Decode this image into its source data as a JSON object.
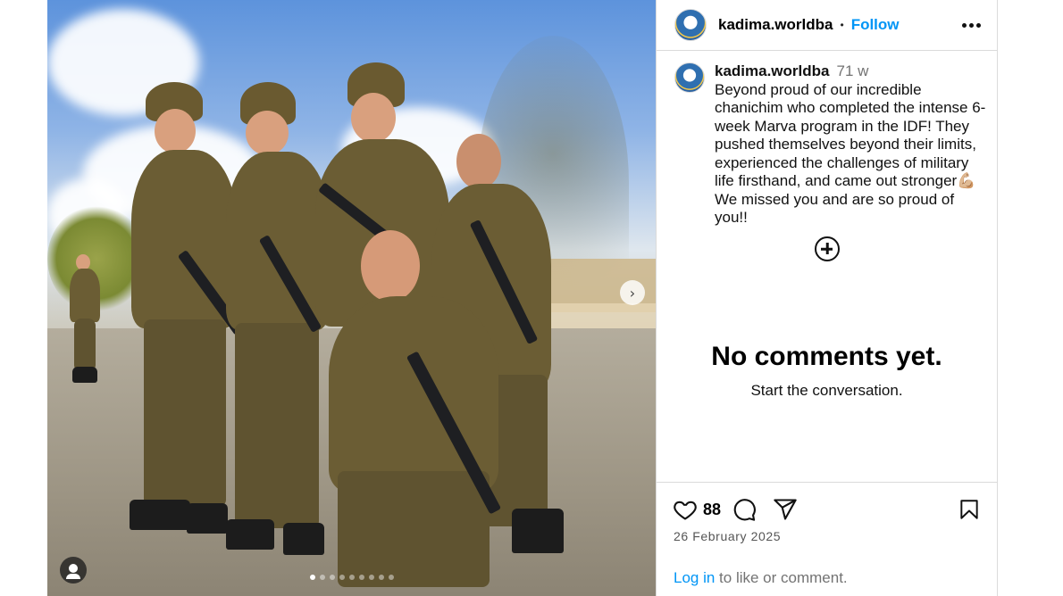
{
  "media": {
    "next_icon": "chevron-right-icon",
    "carousel_slides": 9,
    "active_slide": 1
  },
  "post": {
    "username": "kadima.worldba",
    "separator": "•",
    "follow_label": "Follow",
    "caption_username": "kadima.worldba",
    "caption_time": "71 w",
    "caption_text": "Beyond proud of our incredible chanichim who completed the intense 6-week Marva program in the IDF! They pushed themselves beyond their limits, experienced the challenges of military life firsthand, and came out stronger💪🏼 We missed you and are so proud of you!!"
  },
  "comments": {
    "empty_title": "No comments yet.",
    "empty_subtitle": "Start the conversation."
  },
  "actions": {
    "like_count": "88",
    "date": "26 February 2025",
    "login_link": "Log in",
    "login_text": " to like or comment."
  },
  "colors": {
    "link": "#0095f6",
    "border": "#dbdbdb",
    "muted": "#737373"
  }
}
